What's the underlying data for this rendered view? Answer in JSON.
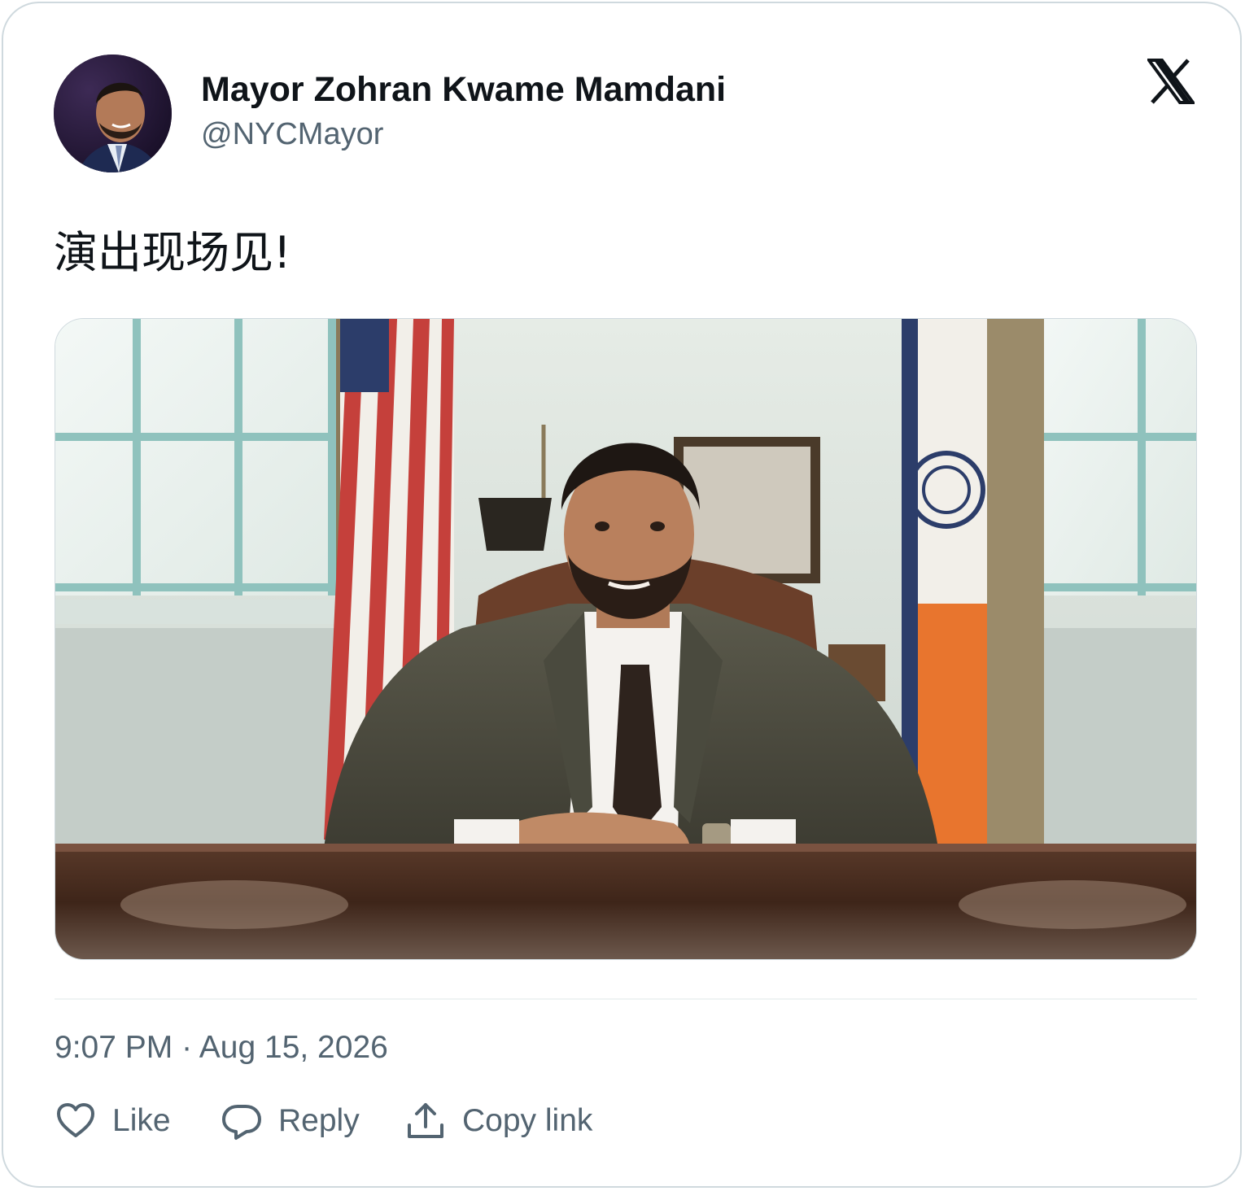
{
  "author": {
    "display_name": "Mayor Zohran Kwame Mamdani",
    "handle": "@NYCMayor",
    "avatar_icon": "profile-photo"
  },
  "brand": {
    "logo_icon": "x-logo-icon"
  },
  "tweet": {
    "text": "演出现场见!",
    "media": {
      "type": "photo",
      "icon": "photo-image"
    },
    "time": "9:07 PM",
    "separator": "·",
    "date": "Aug 15, 2026"
  },
  "actions": [
    {
      "label": "Like",
      "icon": "heart-icon"
    },
    {
      "label": "Reply",
      "icon": "reply-bubble-icon"
    },
    {
      "label": "Copy link",
      "icon": "share-upload-icon"
    }
  ],
  "colors": {
    "text_primary": "#0f1419",
    "text_secondary": "#536471",
    "border": "#cfd9de"
  }
}
